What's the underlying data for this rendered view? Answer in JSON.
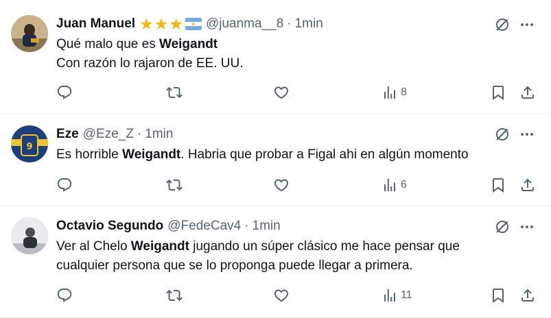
{
  "colors": {
    "icon": "#536471",
    "text": "#0f1419",
    "star": "#f5b60c",
    "divider": "#eff3f4"
  },
  "tweets": [
    {
      "author": "Juan Manuel",
      "handle": "@juanma__8",
      "separator": "·",
      "time": "1min",
      "badges": [
        "star",
        "star",
        "star",
        "argentina-flag"
      ],
      "text_plain_1": "Qué malo que es ",
      "text_bold": "Weigandt",
      "text_line_2": "Con razón lo rajaron de EE. UU.",
      "views": "8"
    },
    {
      "author": "Eze",
      "handle": "@Eze_Z",
      "separator": "·",
      "time": "1min",
      "text_plain_1": "Es horrible ",
      "text_bold": "Weigandt",
      "text_plain_2": ". Habria que probar a Figal ahi en algún momento",
      "views": "6"
    },
    {
      "author": "Octavio Segundo",
      "handle": "@FedeCav4",
      "separator": "·",
      "time": "1min",
      "text_plain_1": "Ver al Chelo ",
      "text_bold": "Weigandt",
      "text_plain_2": " jugando un súper clásico me hace pensar que",
      "text_line_2": "cualquier persona que se lo proponga puede llegar a primera.",
      "views": "11"
    }
  ],
  "actions": [
    "reply-icon",
    "retweet-icon",
    "like-icon",
    "views-icon",
    "bookmark-icon",
    "share-icon"
  ]
}
